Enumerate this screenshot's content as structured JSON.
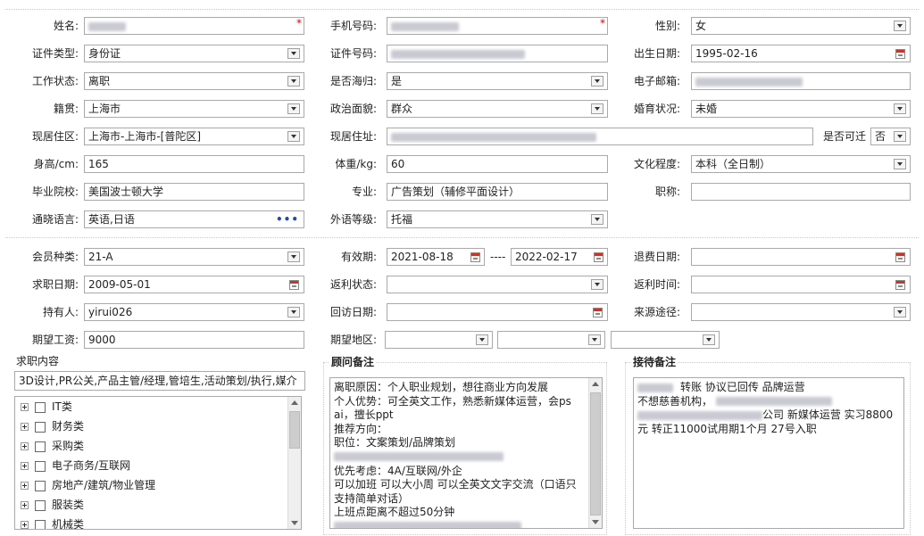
{
  "personal": {
    "name": {
      "label": "姓名:",
      "value": "",
      "required": "*"
    },
    "mobile": {
      "label": "手机号码:",
      "value": "",
      "required": "*"
    },
    "gender": {
      "label": "性别:",
      "value": "女"
    },
    "id_type": {
      "label": "证件类型:",
      "value": "身份证"
    },
    "id_number": {
      "label": "证件号码:",
      "value": ""
    },
    "birth_date": {
      "label": "出生日期:",
      "value": "1995-02-16"
    },
    "work_status": {
      "label": "工作状态:",
      "value": "离职"
    },
    "returnee": {
      "label": "是否海归:",
      "value": "是"
    },
    "email": {
      "label": "电子邮箱:",
      "value": ""
    },
    "native_place": {
      "label": "籍贯:",
      "value": "上海市"
    },
    "political_status": {
      "label": "政治面貌:",
      "value": "群众"
    },
    "marital_status": {
      "label": "婚育状况:",
      "value": "未婚"
    },
    "residence_area": {
      "label": "现居住区:",
      "value": "上海市-上海市-[普陀区]"
    },
    "residence_address": {
      "label": "现居住址:",
      "value": ""
    },
    "relocate": {
      "label": "是否可迁",
      "value": "否"
    },
    "height": {
      "label": "身高/cm:",
      "value": "165"
    },
    "weight": {
      "label": "体重/kg:",
      "value": "60"
    },
    "education": {
      "label": "文化程度:",
      "value": "本科（全日制）"
    },
    "school": {
      "label": "毕业院校:",
      "value": "美国波士顿大学"
    },
    "major": {
      "label": "专业:",
      "value": "广告策划（辅修平面设计）"
    },
    "title": {
      "label": "职称:",
      "value": ""
    },
    "languages": {
      "label": "通晓语言:",
      "value": "英语,日语",
      "more": "•••"
    },
    "language_level": {
      "label": "外语等级:",
      "value": "托福"
    }
  },
  "membership": {
    "member_type": {
      "label": "会员种类:",
      "value": "21-A"
    },
    "valid_period": {
      "label": "有效期:",
      "from": "2021-08-18",
      "separator": "----",
      "to": "2022-02-17"
    },
    "refund_date": {
      "label": "退费日期:",
      "value": ""
    },
    "job_seek_date": {
      "label": "求职日期:",
      "value": "2009-05-01"
    },
    "rebate_status": {
      "label": "返利状态:",
      "value": ""
    },
    "rebate_time": {
      "label": "返利时间:",
      "value": ""
    },
    "holder": {
      "label": "持有人:",
      "value": "yirui026"
    },
    "visit_date": {
      "label": "回访日期:",
      "value": ""
    },
    "source": {
      "label": "来源途径:",
      "value": ""
    },
    "expected_salary": {
      "label": "期望工资:",
      "value": "9000"
    },
    "expected_region": {
      "label": "期望地区:",
      "values": [
        "",
        "",
        ""
      ]
    }
  },
  "job_content": {
    "title": "求职内容",
    "value": "3D设计,PR公关,产品主管/经理,管培生,活动策划/执行,媒介",
    "categories": [
      "IT类",
      "财务类",
      "采购类",
      "电子商务/互联网",
      "房地产/建筑/物业管理",
      "服装类",
      "机械类"
    ]
  },
  "consultant_notes": {
    "title": "顾问备注",
    "lines": [
      "离职原因：个人职业规划，想往商业方向发展",
      "个人优势：可全英文工作，熟悉新媒体运营，会ps",
      "ai，擅长ppt",
      "推荐方向：",
      "职位：文案策划/品牌策划",
      "",
      "优先考虑：4A/互联网/外企",
      "可以加班 可以大小周 可以全英文文字交流（口语只",
      "支持简单对话）",
      "上班点距离不超过50分钟"
    ]
  },
  "reception_notes": {
    "title": "接待备注",
    "line1": "转账 协议已回传 品牌运营",
    "line2": "不想慈善机构，",
    "line3": "公司 新媒体运营 实习8800",
    "line4": "元 转正11000试用期1个月 27号入职"
  }
}
